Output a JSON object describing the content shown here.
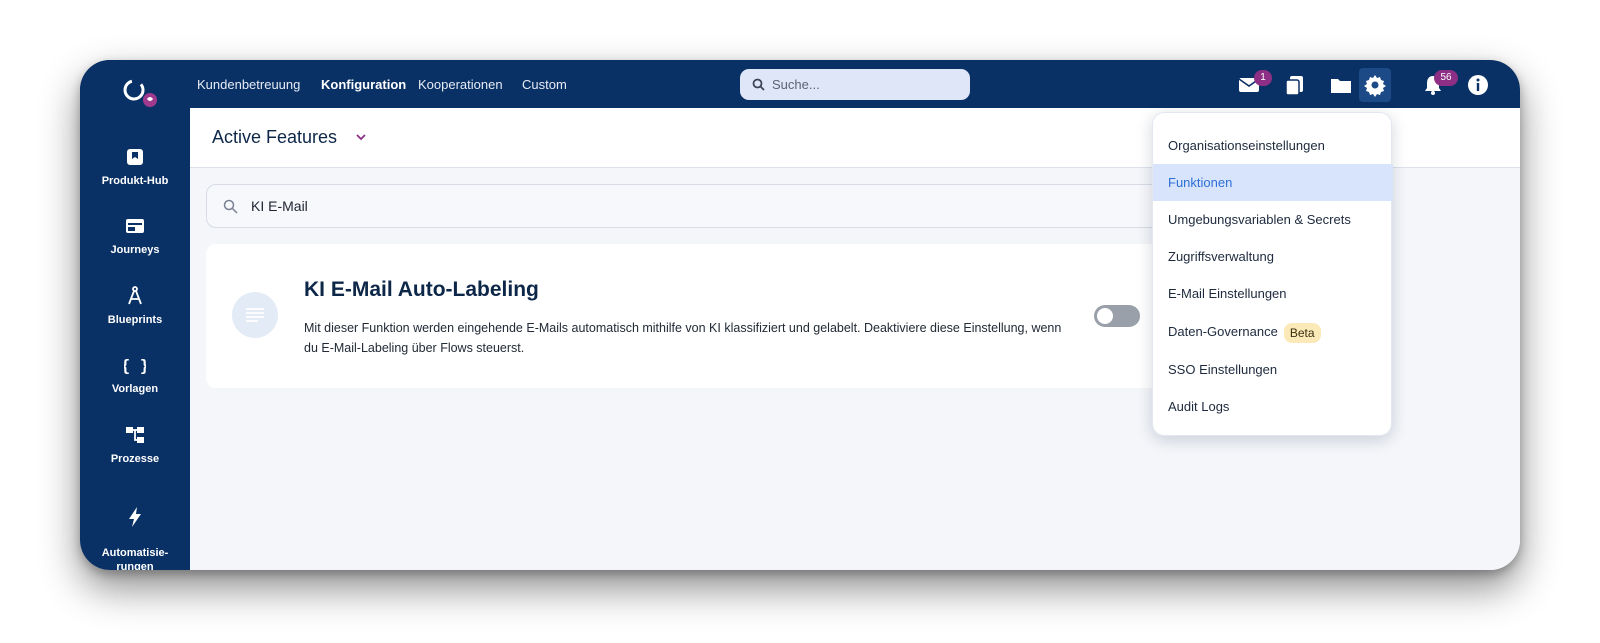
{
  "topnav": {
    "links": [
      "Kundenbetreuung",
      "Konfiguration",
      "Kooperationen",
      "Custom"
    ],
    "active": "Konfiguration",
    "search_placeholder": "Suche...",
    "mail_badge": "1",
    "notifications_badge": "56"
  },
  "sidebar": {
    "items": [
      {
        "label": "Produkt-Hub",
        "icon": "bookmark-icon"
      },
      {
        "label": "Journeys",
        "icon": "browser-window-icon"
      },
      {
        "label": "Blueprints",
        "icon": "compass-icon"
      },
      {
        "label": "Vorlagen",
        "icon": "curly-braces-icon"
      },
      {
        "label": "Prozesse",
        "icon": "process-tree-icon"
      },
      {
        "label": "Automatisie-\nrungen",
        "icon": "lightning-icon"
      }
    ]
  },
  "header": {
    "title": "Active Features"
  },
  "filter": {
    "value": "KI E-Mail"
  },
  "feature_card": {
    "title": "KI E-Mail Auto-Labeling",
    "description": "Mit dieser Funktion werden eingehende E-Mails automatisch mithilfe von KI klassifiziert und gelabelt. Deaktiviere diese Einstellung, wenn du E-Mail-Labeling über Flows steuerst.",
    "enabled": false
  },
  "settings_menu": {
    "items": [
      "Organisationseinstellungen",
      "Funktionen",
      "Umgebungsvariablen & Secrets",
      "Zugriffsverwaltung",
      "E-Mail Einstellungen",
      "Daten-Governance",
      "SSO Einstellungen",
      "Audit Logs"
    ],
    "selected": "Funktionen",
    "beta_label": "Beta"
  }
}
